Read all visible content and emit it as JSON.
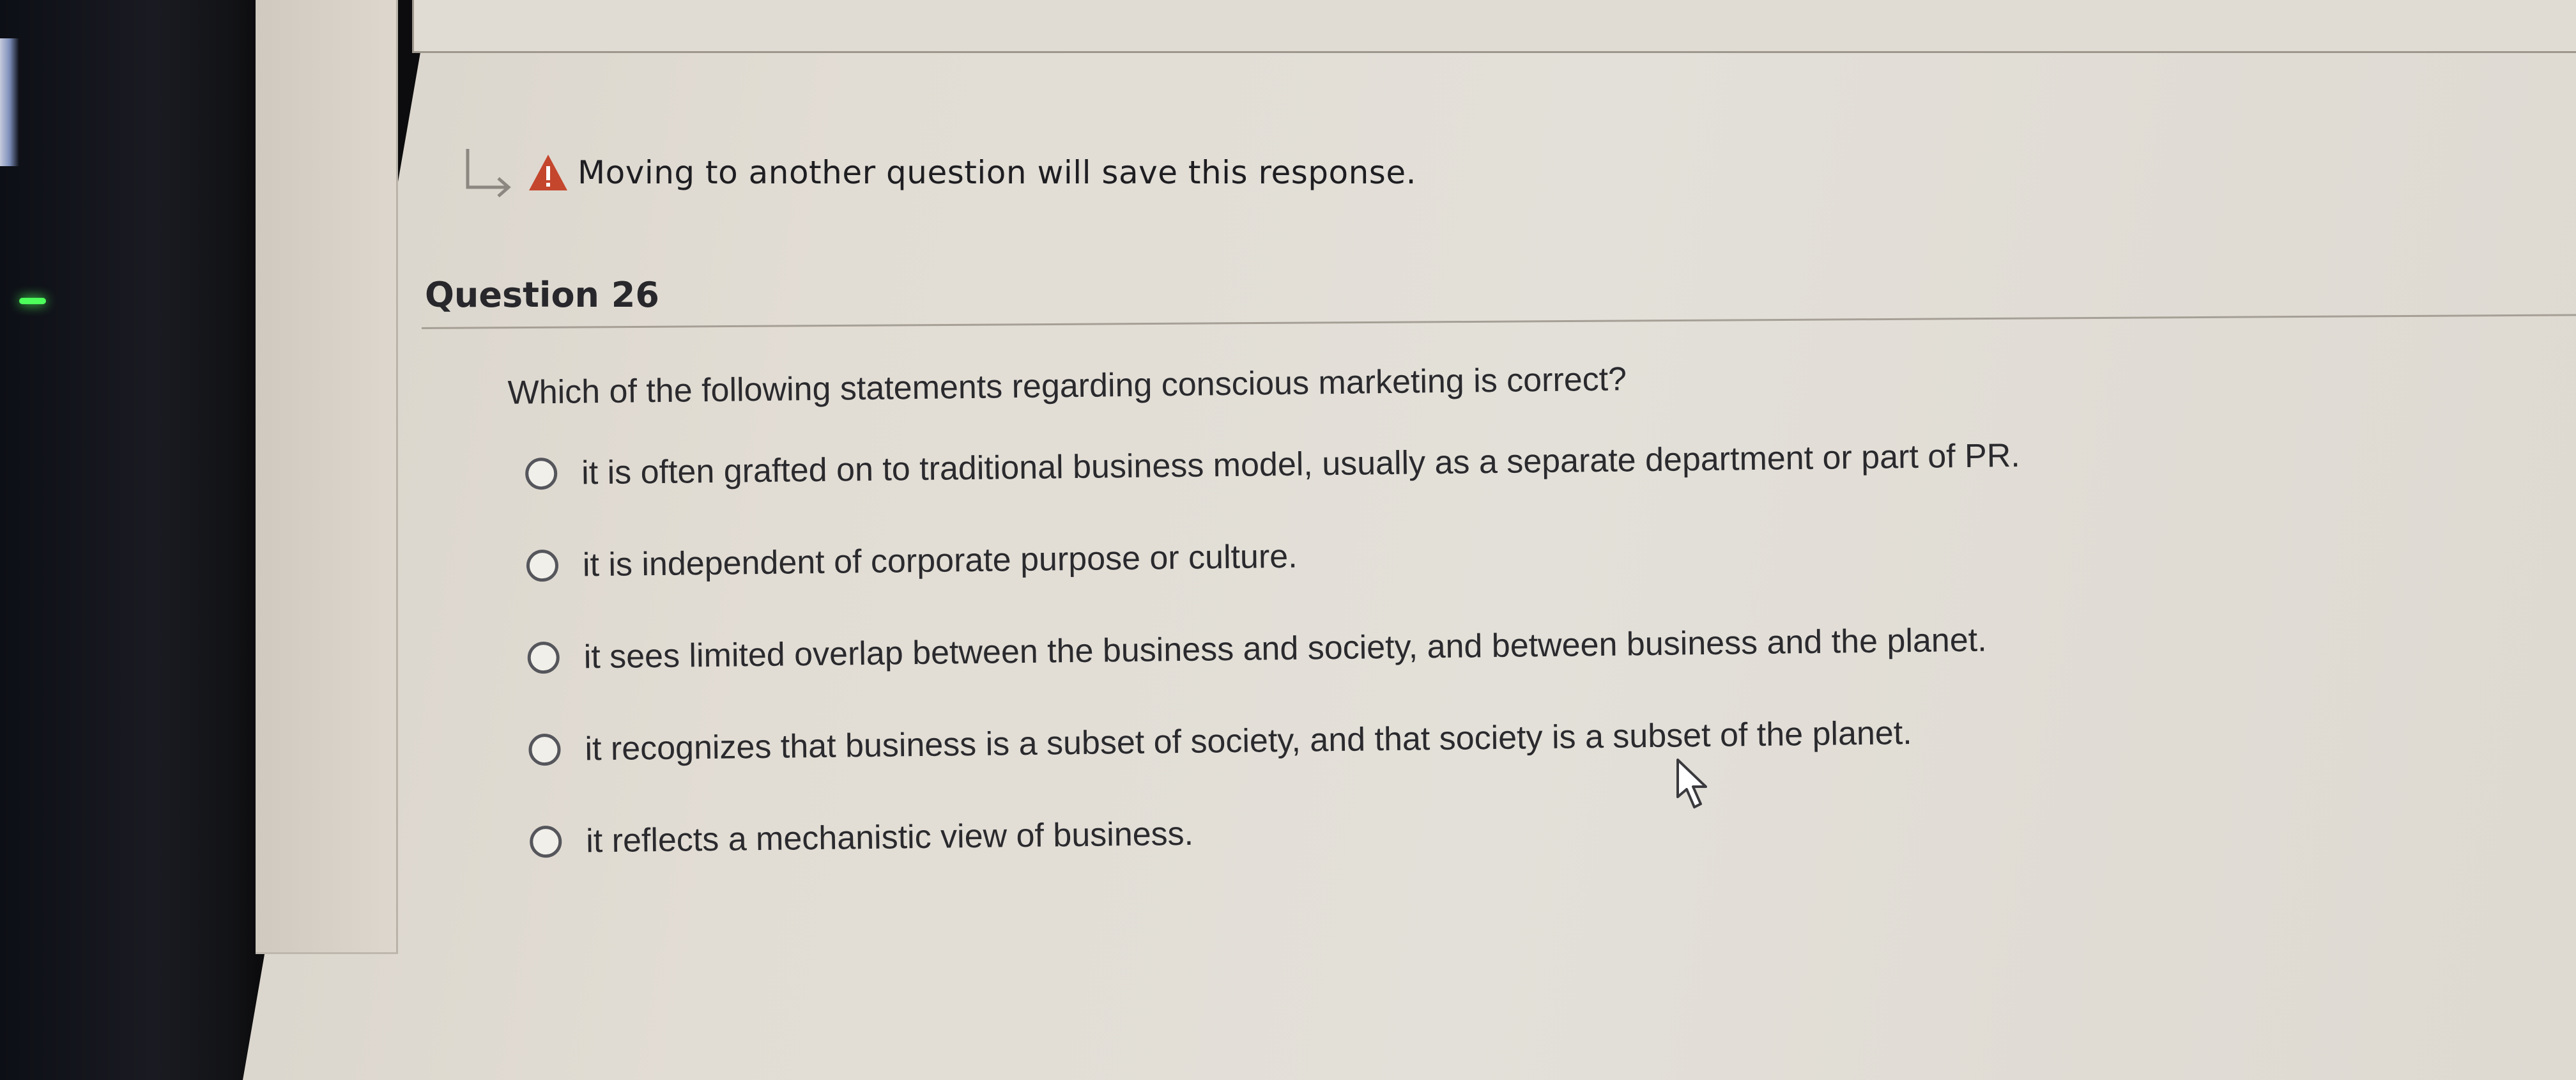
{
  "notice": {
    "text": "Moving to another question will save this response.",
    "icons": [
      "return-arrow-icon",
      "alert-icon"
    ]
  },
  "question": {
    "header": "Question 26",
    "prompt": "Which of the following statements regarding conscious marketing is correct?",
    "options": [
      {
        "label": "it is often grafted on to traditional business model, usually as a separate department or part of PR."
      },
      {
        "label": "it is independent of corporate purpose or culture."
      },
      {
        "label": "it sees limited overlap between the business and society, and between business and the planet."
      },
      {
        "label": "it recognizes that business is a subset of society, and that society is a subset of the planet."
      },
      {
        "label": "it reflects a mechanistic view of business."
      }
    ]
  },
  "colors": {
    "alert": "#c4462d",
    "text": "#2a2a2e",
    "radio_border": "#55565c"
  }
}
